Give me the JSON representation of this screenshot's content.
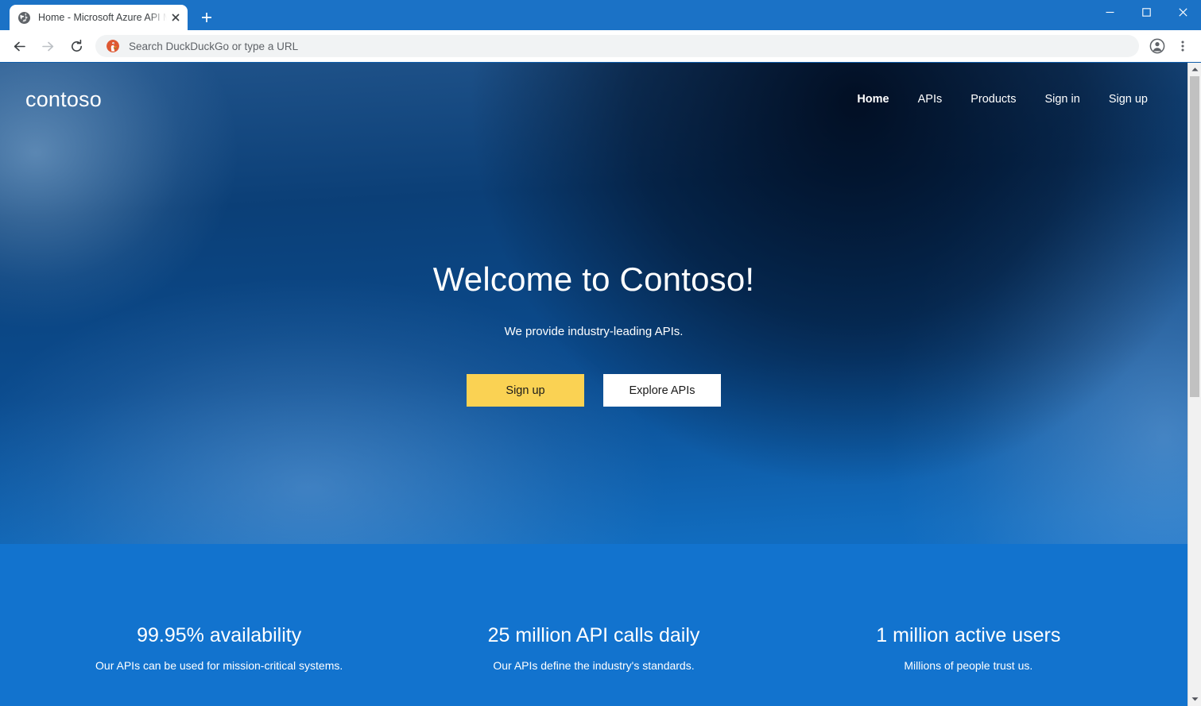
{
  "window": {
    "tab": {
      "title": "Home - Microsoft Azure API Man",
      "favicon": "globe-icon",
      "close": "×"
    },
    "new_tab_label": "+",
    "controls": {
      "minimize": "minimize-icon",
      "maximize": "maximize-icon",
      "close": "close-icon"
    },
    "titlebar_color": "#1B72C6"
  },
  "toolbar": {
    "back": "back-arrow-icon",
    "forward": "forward-arrow-icon",
    "reload": "reload-icon",
    "omnibox": {
      "icon": "duckduckgo-icon",
      "value": "",
      "placeholder": "Search DuckDuckGo or type a URL"
    },
    "profile": "profile-avatar-icon",
    "menu": "three-dot-menu-icon"
  },
  "scrollbar": {
    "up": "chevron-up-icon",
    "down": "chevron-down-icon",
    "thumb_color": "#C1C1C1",
    "track_color": "#F1F1F1"
  },
  "site": {
    "logo": "contoso",
    "nav": [
      {
        "label": "Home",
        "active": true
      },
      {
        "label": "APIs",
        "active": false
      },
      {
        "label": "Products",
        "active": false
      },
      {
        "label": "Sign in",
        "active": false
      },
      {
        "label": "Sign up",
        "active": false
      }
    ],
    "hero": {
      "title": "Welcome to Contoso!",
      "subtitle": "We provide industry-leading APIs.",
      "primary_cta": "Sign up",
      "secondary_cta": "Explore APIs"
    },
    "stats": [
      {
        "headline": "99.95% availability",
        "body": "Our APIs can be used for mission-critical systems."
      },
      {
        "headline": "25 million API calls daily",
        "body": "Our APIs define the industry's standards."
      },
      {
        "headline": "1 million active users",
        "body": "Millions of people trust us."
      }
    ],
    "colors": {
      "accent_yellow": "#FAD253",
      "hero_blue": "#1273CE",
      "hero_dark": "#072544"
    }
  }
}
